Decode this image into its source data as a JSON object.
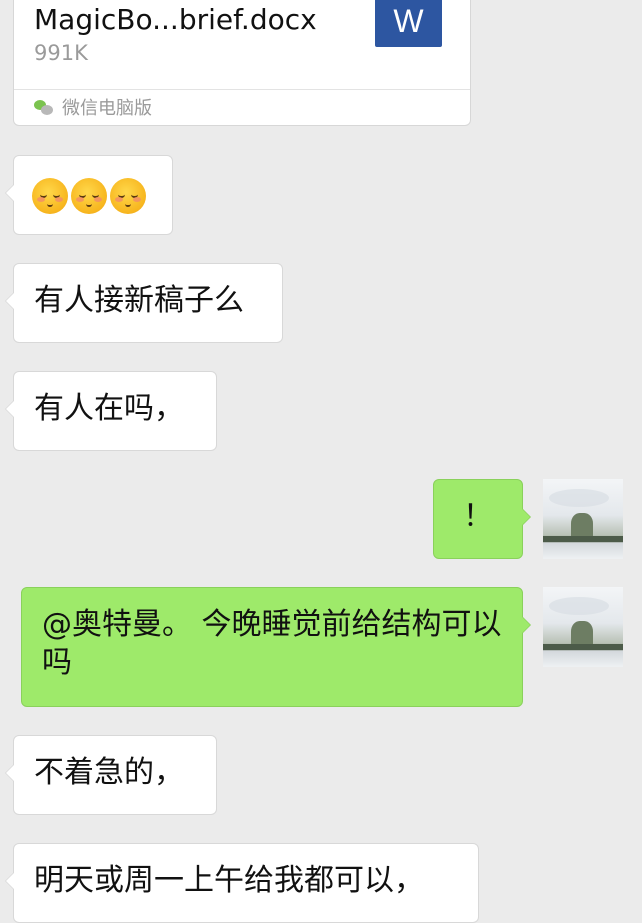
{
  "file_card": {
    "file_name": "MagicBo...brief.docx",
    "file_size": "991K",
    "file_icon_letter": "W",
    "file_icon_color": "#2d56a1",
    "source_label": "微信电脑版"
  },
  "messages": [
    {
      "side": "left",
      "text": "",
      "emoji_count": 3
    },
    {
      "side": "left",
      "text": "有人接新稿子么"
    },
    {
      "side": "left",
      "text": "有人在吗，"
    },
    {
      "side": "right",
      "text": "！"
    },
    {
      "side": "right",
      "text": "@奥特曼。 今晚睡觉前给结构可以吗"
    },
    {
      "side": "left",
      "text": "不着急的，"
    },
    {
      "side": "left",
      "text": "明天或周一上午给我都可以，"
    }
  ],
  "colors": {
    "background": "#ebebeb",
    "incoming_bubble": "#ffffff",
    "outgoing_bubble": "#9eea6a"
  }
}
